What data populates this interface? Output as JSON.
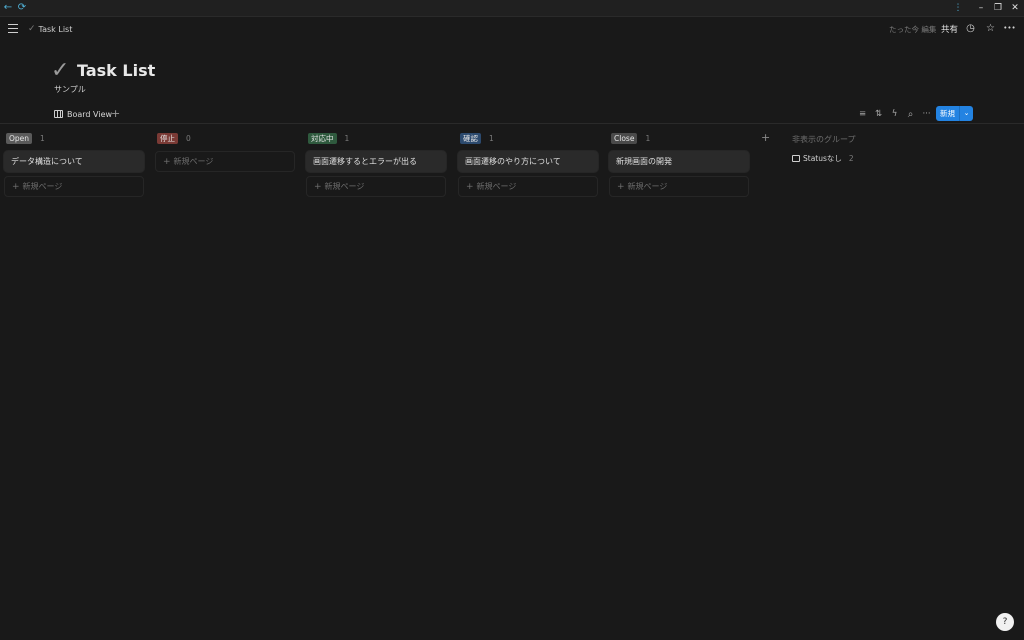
{
  "chrome": {
    "back_glyph": "←",
    "reload_glyph": "⟳",
    "menu_glyph": "⋮",
    "minimize_glyph": "–",
    "maximize_glyph": "❐",
    "close_glyph": "✕"
  },
  "topbar": {
    "breadcrumb": "Task List",
    "edited": "たった今 編集",
    "share": "共有",
    "history_glyph": "◷",
    "favorite_glyph": "☆",
    "more_glyph": "•••"
  },
  "page": {
    "icon_glyph": "✓",
    "title": "Task List",
    "subtitle": "サンプル"
  },
  "viewbar": {
    "view_name": "Board View",
    "add_glyph": "+",
    "filter_glyph": "≡",
    "sort_glyph": "⇅",
    "automation_glyph": "ϟ",
    "search_glyph": "⌕",
    "more_glyph": "···",
    "new_label": "新規",
    "new_chevron": "⌄"
  },
  "board": {
    "new_page_label": "新規ページ",
    "columns": [
      {
        "name": "Open",
        "count": "1",
        "color": "#5a5a5a",
        "cards": [
          "データ構造について"
        ]
      },
      {
        "name": "停止",
        "count": "0",
        "color": "#7a3a35",
        "cards": []
      },
      {
        "name": "対応中",
        "count": "1",
        "color": "#2f5a3e",
        "cards": [
          "画面遷移するとエラーが出る"
        ]
      },
      {
        "name": "確認",
        "count": "1",
        "color": "#2c4a6e",
        "cards": [
          "画面遷移のやり方について"
        ]
      },
      {
        "name": "Close",
        "count": "1",
        "color": "#4a4a4a",
        "cards": [
          "新規画面の開発"
        ]
      }
    ],
    "add_group_glyph": "+",
    "hidden_groups_title": "非表示のグループ",
    "hidden_group": {
      "name": "Statusなし",
      "count": "2"
    }
  },
  "help_glyph": "?"
}
